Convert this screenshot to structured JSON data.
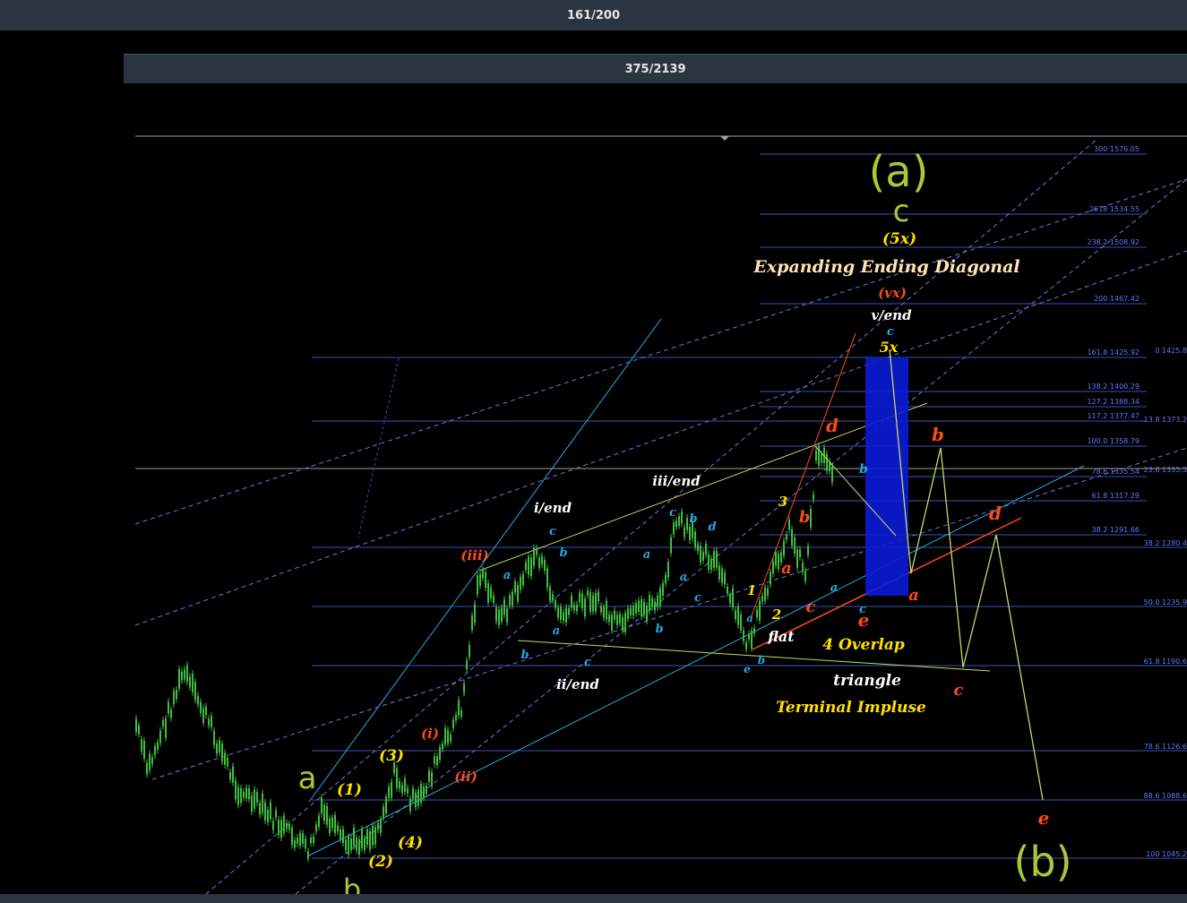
{
  "header": {
    "counter": "161/200"
  },
  "subheader": {
    "counter": "375/2139"
  },
  "colors": {
    "background": "#000000",
    "bar": "#2b3542",
    "fib_line": "#3a4fb8",
    "fib_text": "#5c78ff",
    "candle": "#3fbf3f",
    "red": "#ff4a1a",
    "yellow": "#ffe000",
    "olive": "#a8c83a",
    "cyan": "#2aa6e6",
    "box": "#0b1bd6"
  },
  "chart_data": {
    "type": "candlestick",
    "fib_levels_right": [
      {
        "ratio": "300",
        "price": "1576.05"
      },
      {
        "ratio": "2618",
        "price": "1534.55"
      },
      {
        "ratio": "238.2",
        "price": "1508.92"
      },
      {
        "ratio": "200",
        "price": "1467.42"
      },
      {
        "ratio": "161.8",
        "price": "1425.92"
      },
      {
        "ratio": "138.2",
        "price": "1400.29"
      },
      {
        "ratio": "127.2",
        "price": "1388.34"
      },
      {
        "ratio": "117.2",
        "price": "1377.47"
      },
      {
        "ratio": "100.0",
        "price": "1358.79"
      },
      {
        "ratio": "78.6",
        "price": "1335.54"
      },
      {
        "ratio": "61.8",
        "price": "1317.29"
      },
      {
        "ratio": "38.2",
        "price": "1291.66"
      }
    ],
    "fib_levels_edge": [
      {
        "ratio": "0",
        "price": "1425.8"
      },
      {
        "ratio": "13.8",
        "price": "1373.2"
      },
      {
        "ratio": "23.6",
        "price": "1335.5"
      },
      {
        "ratio": "38.2",
        "price": "1280.4"
      },
      {
        "ratio": "50.0",
        "price": "1235.9"
      },
      {
        "ratio": "61.8",
        "price": "1190.6"
      },
      {
        "ratio": "78.6",
        "price": "1126.6"
      },
      {
        "ratio": "88.6",
        "price": "1088.6"
      },
      {
        "ratio": "100",
        "price": "1045.2"
      }
    ],
    "annotations": {
      "wave_a_top": "(a)",
      "wave_c_top": "c",
      "wave_5x": "(5x)",
      "title": "Expanding Ending Diagonal",
      "wave_vx": "(vx)",
      "v_end": "v/end",
      "c_small": "c",
      "five_x": "5x",
      "iii_end": "iii/end",
      "i_end": "i/end",
      "ii_end": "ii/end",
      "flat": "flat",
      "overlap": "4 Overlap",
      "triangle": "triangle",
      "terminal": "Terminal Impluse",
      "wave_b_bottom": "(b)",
      "wave_a_left": "a",
      "wave_b_left": "b"
    }
  }
}
